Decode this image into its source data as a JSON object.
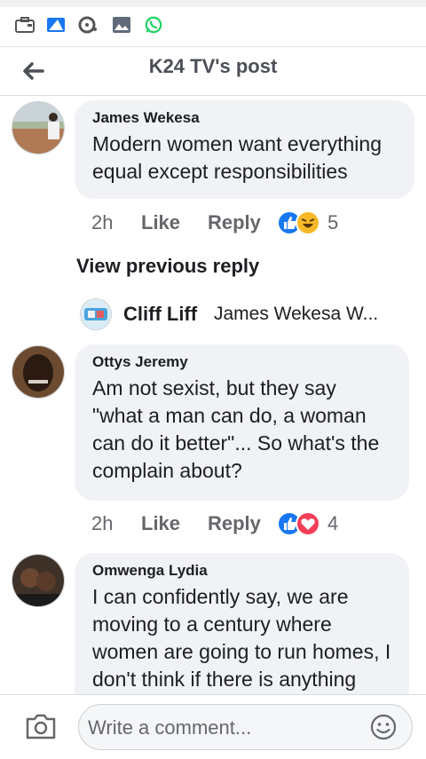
{
  "header": {
    "title": "K24 TV's post"
  },
  "comments": [
    {
      "author": "James Wekesa",
      "text": "Modern women want everything equal except responsibilities",
      "time": "2h",
      "like": "Like",
      "reply": "Reply",
      "reaction_count": "5",
      "reactions": [
        "like-icon",
        "haha-icon"
      ]
    },
    {
      "author": "Ottys Jeremy",
      "text": "Am not sexist, but they say \"what a man can do, a woman can do it better\"... So what's the complain about?",
      "time": "2h",
      "like": "Like",
      "reply": "Reply",
      "reaction_count": "4",
      "reactions": [
        "like-icon",
        "love-icon"
      ]
    },
    {
      "author": "Omwenga Lydia",
      "text": "I can confidently say, we are moving to a century where women are going to run homes, I don't think if there is anything"
    }
  ],
  "thread": {
    "view_previous": "View previous reply",
    "reply_author": "Cliff Liff",
    "reply_preview": "James Wekesa W..."
  },
  "composer": {
    "placeholder": "Write a comment..."
  },
  "colors": {
    "like_blue": "#1877f2",
    "haha_yellow": "#f7b928",
    "love_red": "#f33e58",
    "whatsapp_green": "#25d366"
  }
}
